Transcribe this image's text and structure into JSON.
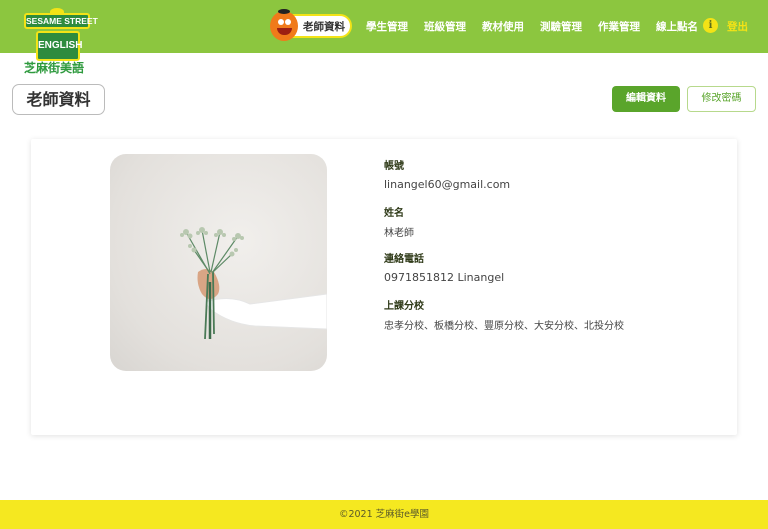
{
  "logo": {
    "line1": "SESAME STREET",
    "line2": "ENGLISH",
    "chinese": "芝麻街美語"
  },
  "nav": {
    "teacher_profile": "老師資料",
    "items": [
      "學生管理",
      "班級管理",
      "教材使用",
      "測驗管理",
      "作業管理",
      "線上點名"
    ],
    "logout": "登出",
    "info_icon": "info-icon"
  },
  "page": {
    "title": "老師資料",
    "edit_button": "編輯資料",
    "change_password_button": "修改密碼"
  },
  "profile": {
    "account_label": "帳號",
    "account_value": "linangel60@gmail.com",
    "name_label": "姓名",
    "name_value": "林老師",
    "phone_label": "連絡電話",
    "phone_value": "0971851812 Linangel",
    "branches_label": "上課分校",
    "branches_value": "忠孝分校、板橋分校、豐原分校、大安分校、北投分校"
  },
  "footer": {
    "copyright": "©2021 芝麻街e學園"
  },
  "colors": {
    "header": "#8cc63f",
    "accent_green": "#5aa52b",
    "yellow": "#f3e316",
    "footer": "#f5e820"
  }
}
